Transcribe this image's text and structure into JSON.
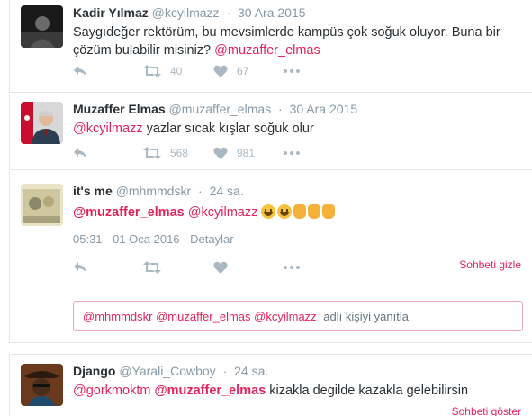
{
  "tweets": [
    {
      "fullname": "Kadir Yılmaz",
      "username": "@kcyilmazz",
      "time": "30 Ara 2015",
      "text_line1": "Saygıdeğer rektörüm, bu mevsimlerde kampüs çok soğuk oluyor. Buna bir",
      "text_line2": "çözüm bulabilir misiniz?",
      "mention": "@muzaffer_elmas",
      "retweets": "40",
      "likes": "67"
    },
    {
      "fullname": "Muzaffer Elmas",
      "username": "@muzaffer_elmas",
      "time": "30 Ara 2015",
      "mention": "@kcyilmazz",
      "text": "yazlar sıcak kışlar soğuk olur",
      "retweets": "568",
      "likes": "981"
    }
  ],
  "focused_tweet": {
    "fullname": "it's me",
    "username": "@mhmmdskr",
    "time": "24 sa.",
    "mention1": "@muzaffer_elmas",
    "mention2": "@kcyilmazz",
    "timestamp": "05:31 - 01 Oca 2016",
    "separator": "·",
    "details_link": "Detaylar",
    "hide_conversation": "Sohbeti gizle"
  },
  "reply_box": {
    "mentions": "@mhmmdskr @muzaffer_elmas @kcyilmazz",
    "placeholder": "adlı kişiyi yanıtla"
  },
  "next_tweet": {
    "fullname": "Django",
    "username": "@Yarali_Cowboy",
    "time": "24 sa.",
    "mention1": "@gorkmoktm",
    "mention2": "@muzaffer_elmas",
    "text": "kizakla degilde kazakla gelebilirsin",
    "show_conversation": "Sohbeti göster"
  },
  "dot": "·",
  "colors": {
    "accent": "#e0245e",
    "muted": "#8899a6",
    "icon": "#aab8c2"
  },
  "icons": [
    "reply-icon",
    "retweet-icon",
    "like-icon",
    "more-icon"
  ]
}
